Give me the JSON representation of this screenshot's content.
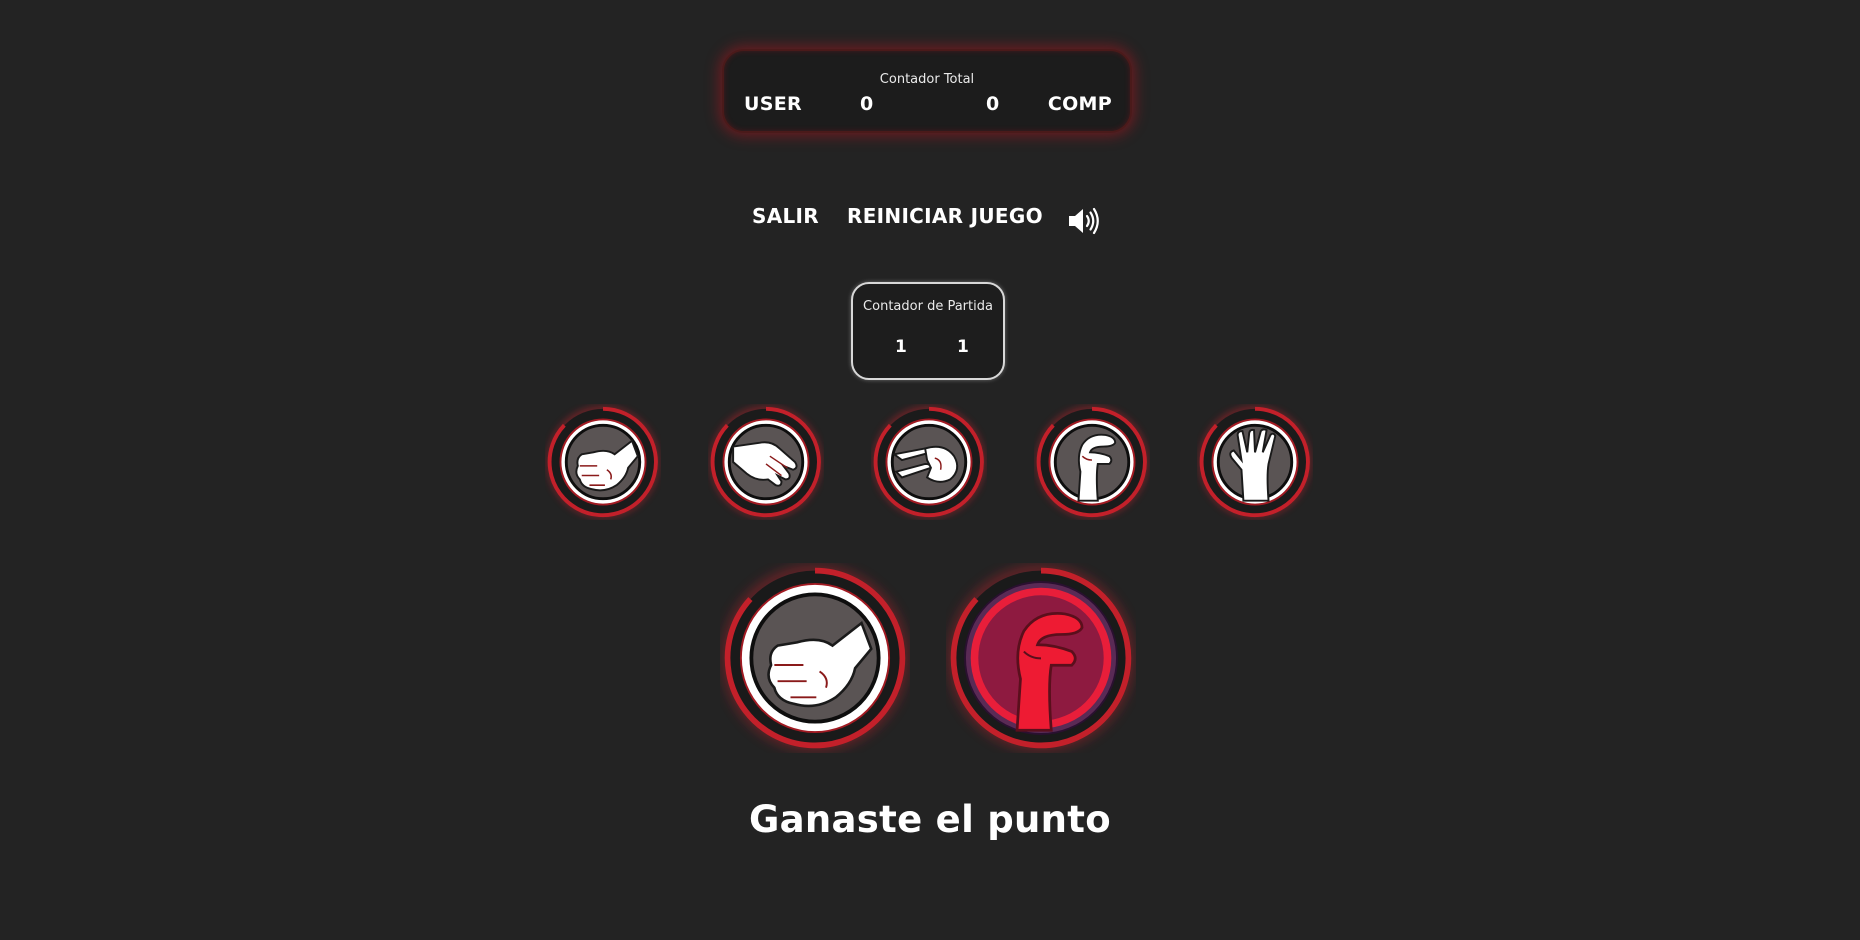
{
  "scoreboard": {
    "title": "Contador Total",
    "user_label": "USER",
    "user_score": "0",
    "comp_score": "0",
    "comp_label": "COMP"
  },
  "controls": {
    "exit_label": "SALIR",
    "restart_label": "REINICIAR JUEGO",
    "sound_icon": "speaker-volume-icon"
  },
  "round": {
    "title": "Contador de Partida",
    "user_score": "1",
    "comp_score": "1"
  },
  "choices": [
    {
      "name": "rock",
      "icon": "fist-icon"
    },
    {
      "name": "paper",
      "icon": "open-hand-icon"
    },
    {
      "name": "scissors",
      "icon": "scissors-hand-icon"
    },
    {
      "name": "lizard",
      "icon": "lizard-hand-icon"
    },
    {
      "name": "spock",
      "icon": "spock-hand-icon"
    }
  ],
  "played": {
    "user_choice": "rock",
    "user_icon": "fist-icon",
    "comp_choice": "lizard",
    "comp_icon": "lizard-hand-icon"
  },
  "result_message": "Ganaste el punto",
  "colors": {
    "background": "#232323",
    "accent_red": "#c3202a",
    "glow_red": "#e0242e",
    "comp_hand": "#ee1b33",
    "comp_fill": "#8e1a40",
    "neutral_fill": "#5a5454"
  }
}
